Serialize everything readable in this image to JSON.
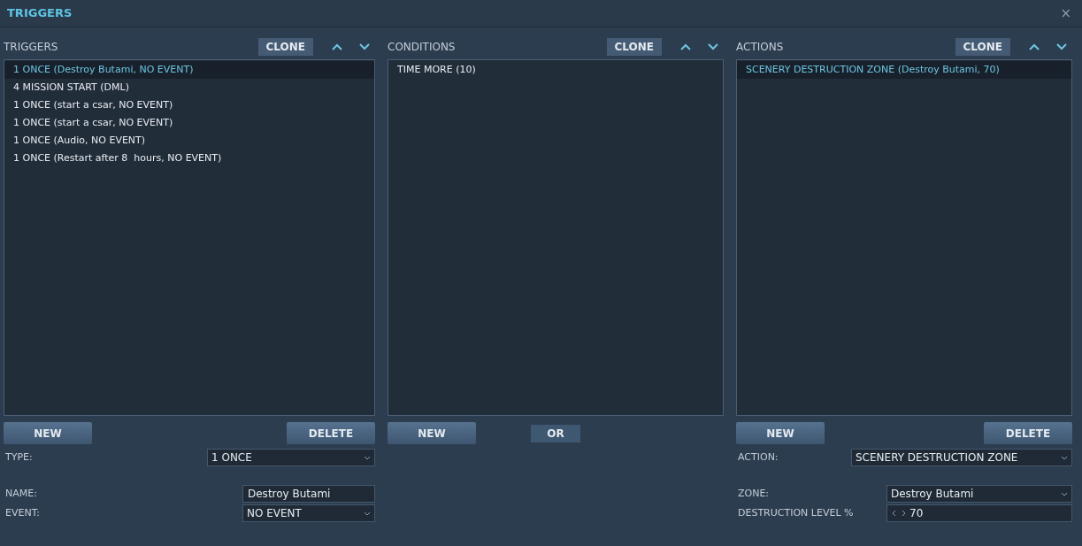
{
  "window": {
    "title": "TRIGGERS",
    "close": "×"
  },
  "panels": [
    {
      "title": "TRIGGERS",
      "clone": "CLONE",
      "items": [
        {
          "label": "1 ONCE (Destroy Butami, NO EVENT)",
          "selected": true
        },
        {
          "label": "4 MISSION START (DML)",
          "selected": false
        },
        {
          "label": "1 ONCE (start a csar, NO EVENT)",
          "selected": false
        },
        {
          "label": "1 ONCE (start a csar, NO EVENT)",
          "selected": false
        },
        {
          "label": "1 ONCE (Audio, NO EVENT)",
          "selected": false
        },
        {
          "label": "1 ONCE (Restart after 8  hours, NO EVENT)",
          "selected": false
        }
      ],
      "buttons": [
        {
          "label": "NEW",
          "kind": "wide"
        },
        {
          "label": "DELETE",
          "kind": "wide"
        }
      ],
      "field_groups": [
        [
          {
            "label": "TYPE:",
            "kind": "select",
            "value": "1 ONCE"
          }
        ],
        [
          {
            "label": "NAME:",
            "kind": "text",
            "value": "Destroy Butami"
          },
          {
            "label": "EVENT:",
            "kind": "select",
            "value": "NO EVENT"
          }
        ]
      ]
    },
    {
      "title": "CONDITIONS",
      "clone": "CLONE",
      "items": [
        {
          "label": "TIME MORE (10)",
          "selected": false
        }
      ],
      "buttons": [
        {
          "label": "NEW",
          "kind": "wide"
        },
        {
          "label": "OR",
          "kind": "narrow"
        }
      ]
    },
    {
      "title": "ACTIONS",
      "clone": "CLONE",
      "items": [
        {
          "label": "SCENERY DESTRUCTION ZONE (Destroy Butami, 70)",
          "selected": true
        }
      ],
      "buttons": [
        {
          "label": "NEW",
          "kind": "wide"
        },
        {
          "label": "DELETE",
          "kind": "wide"
        }
      ],
      "field_groups": [
        [
          {
            "label": "ACTION:",
            "kind": "select",
            "value": "SCENERY DESTRUCTION ZONE"
          }
        ],
        [
          {
            "label": "ZONE:",
            "kind": "select",
            "value": "Destroy Butami"
          },
          {
            "label": "DESTRUCTION LEVEL %",
            "kind": "spinner",
            "value": "70"
          }
        ]
      ]
    }
  ]
}
